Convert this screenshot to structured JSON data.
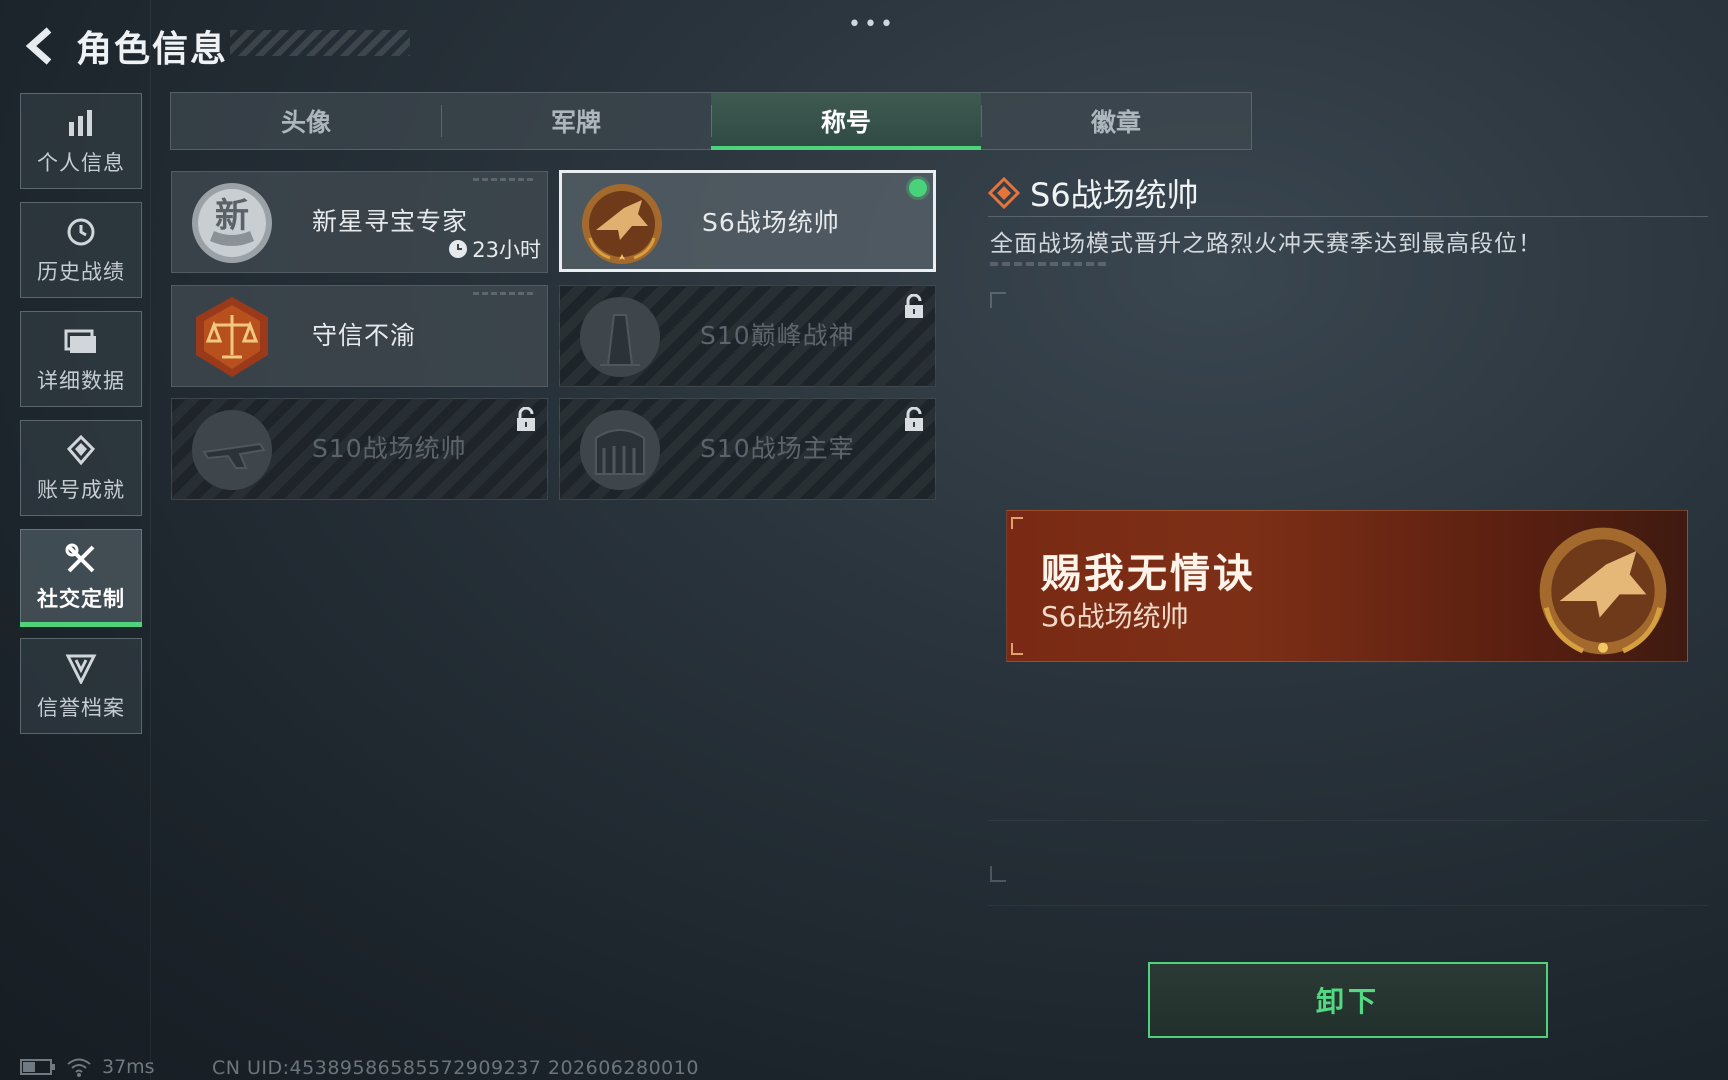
{
  "header": {
    "title": "角色信息",
    "more": "•••"
  },
  "sidebar": {
    "items": [
      {
        "label": "个人信息",
        "icon": "bar-chart-icon",
        "active": false
      },
      {
        "label": "历史战绩",
        "icon": "history-clock-icon",
        "active": false
      },
      {
        "label": "详细数据",
        "icon": "folder-icon",
        "active": false
      },
      {
        "label": "账号成就",
        "icon": "achievement-medal-icon",
        "active": false
      },
      {
        "label": "社交定制",
        "icon": "wrench-tools-icon",
        "active": true
      },
      {
        "label": "信誉档案",
        "icon": "reputation-shield-icon",
        "active": false
      }
    ]
  },
  "tabs": [
    {
      "label": "头像",
      "active": false
    },
    {
      "label": "军牌",
      "active": false
    },
    {
      "label": "称号",
      "active": true
    },
    {
      "label": "徽章",
      "active": false
    }
  ],
  "titles": [
    {
      "name": "新星寻宝专家",
      "emblem": "new-star-emblem-icon",
      "timer": "23小时",
      "locked": false,
      "selected": false
    },
    {
      "name": "S6战场统帅",
      "emblem": "jet-fighter-emblem-icon",
      "locked": false,
      "selected": true
    },
    {
      "name": "守信不渝",
      "emblem": "scales-justice-emblem-icon",
      "locked": false,
      "selected": false
    },
    {
      "name": "S10巅峰战神",
      "emblem": "tower-emblem-icon",
      "locked": true,
      "selected": false
    },
    {
      "name": "S10战场统帅",
      "emblem": "aircraft-emblem-icon",
      "locked": true,
      "selected": false
    },
    {
      "name": "S10战场主宰",
      "emblem": "colosseum-emblem-icon",
      "locked": true,
      "selected": false
    }
  ],
  "detail": {
    "name": "S6战场统帅",
    "description": "全面战场模式晋升之路烈火冲天赛季达到最高段位！"
  },
  "preview": {
    "player_name": "赐我无情诀",
    "title": "S6战场统帅"
  },
  "actions": {
    "unequip_label": "卸下"
  },
  "status": {
    "ping": "37ms",
    "uid": "CN UID:4538958658557290923​7 202606280010"
  },
  "colors": {
    "accent": "#4fd27c",
    "banner": "#7a2a14",
    "gold": "#c98a3c"
  }
}
